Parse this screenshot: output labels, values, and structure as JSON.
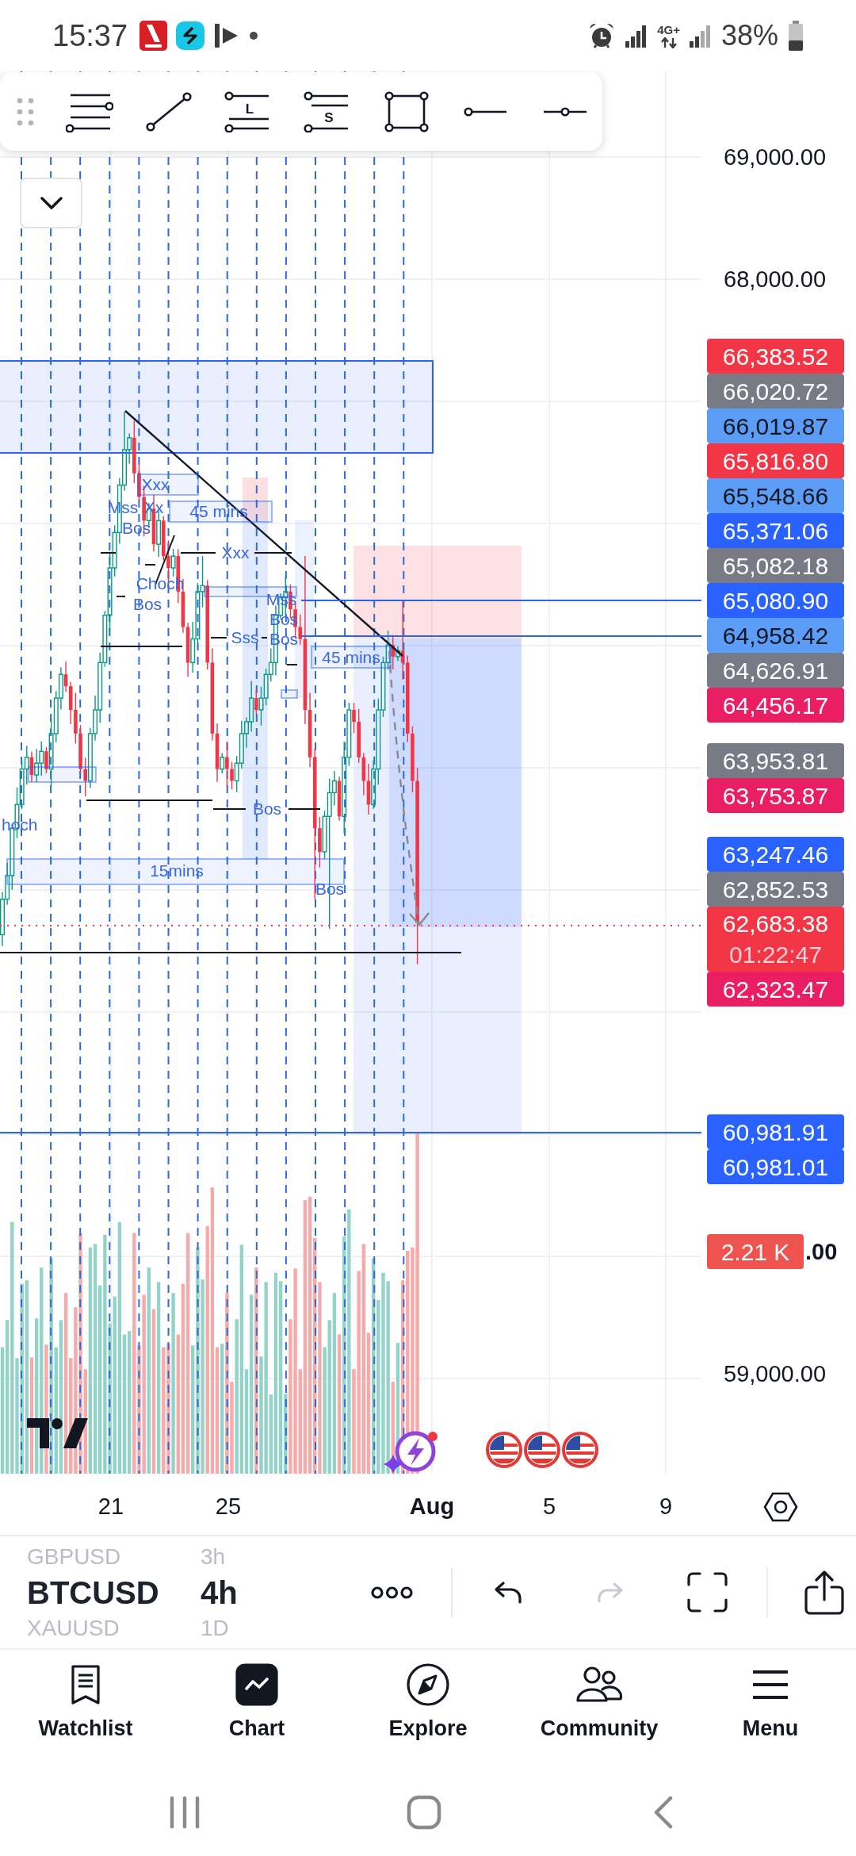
{
  "status_bar": {
    "time": "15:37",
    "network": "4G+",
    "battery": "38%"
  },
  "drawing_tools": [
    {
      "kind": "parallel"
    },
    {
      "kind": "trend"
    },
    {
      "kind": "long",
      "letter": "L"
    },
    {
      "kind": "short",
      "letter": "S"
    },
    {
      "kind": "rectangle"
    },
    {
      "kind": "ray"
    },
    {
      "kind": "horizontal"
    }
  ],
  "chart": {
    "annotations": [
      "Xxx",
      "Mss",
      "Xx",
      "45 mins",
      "Bos",
      "Xxx",
      "Choch",
      "Bos",
      "Mss",
      "Bos",
      "Sss",
      "Bos",
      "45 mins",
      "Bos",
      "hoch",
      "15mins",
      "Bos"
    ],
    "price_ticks": [
      {
        "label": "69,000.00",
        "highlighted": false
      },
      {
        "label": "68,000.00",
        "highlighted": false
      },
      {
        "label": ".00",
        "highlighted": true
      },
      {
        "label": "59,000.00",
        "highlighted": false
      }
    ],
    "price_label_groups": [
      [
        {
          "value": "66,383.52",
          "color": "#f23645"
        },
        {
          "value": "66,020.72",
          "color": "#787b86"
        },
        {
          "value": "66,019.87",
          "color": "#5b9cf6"
        },
        {
          "value": "65,816.80",
          "color": "#f23645"
        },
        {
          "value": "65,548.66",
          "color": "#5b9cf6"
        },
        {
          "value": "65,371.06",
          "color": "#2962ff"
        },
        {
          "value": "65,082.18",
          "color": "#787b86"
        },
        {
          "value": "65,080.90",
          "color": "#2962ff"
        },
        {
          "value": "64,958.42",
          "color": "#5b9cf6"
        },
        {
          "value": "64,626.91",
          "color": "#787b86"
        },
        {
          "value": "64,456.17",
          "color": "#e91e63"
        }
      ],
      [
        {
          "value": "63,953.81",
          "color": "#787b86"
        },
        {
          "value": "63,753.87",
          "color": "#e91e63"
        }
      ],
      [
        {
          "value": "63,247.46",
          "color": "#2962ff"
        },
        {
          "value": "62,852.53",
          "color": "#787b86"
        },
        {
          "value": "62,683.38",
          "countdown": "01:22:47",
          "color": "#f23645"
        },
        {
          "value": "62,323.47",
          "color": "#e91e63"
        }
      ],
      [
        {
          "value": "60,981.91",
          "color": "#2962ff"
        },
        {
          "value": "60,981.01",
          "color": "#2962ff"
        }
      ]
    ],
    "volume_label": {
      "value": "2.21 K",
      "color": "#ef5350"
    },
    "time_labels": [
      {
        "label": "21",
        "kind": "day"
      },
      {
        "label": "25",
        "kind": "day"
      },
      {
        "label": "Aug",
        "kind": "month"
      },
      {
        "label": "5",
        "kind": "day"
      },
      {
        "label": "9",
        "kind": "day"
      }
    ]
  },
  "symbol_switcher": [
    {
      "symbol": "GBPUSD",
      "interval": "3h",
      "selected": false
    },
    {
      "symbol": "BTCUSD",
      "interval": "4h",
      "selected": true
    },
    {
      "symbol": "XAUUSD",
      "interval": "1D",
      "selected": false
    }
  ],
  "toolbar_actions": [
    {
      "kind": "more",
      "disabled": false
    },
    {
      "kind": "undo",
      "disabled": false
    },
    {
      "kind": "redo",
      "disabled": true
    },
    {
      "kind": "fullscreen",
      "disabled": false
    },
    {
      "kind": "share",
      "disabled": false
    }
  ],
  "bottom_nav": [
    {
      "label": "Watchlist",
      "selected": false
    },
    {
      "label": "Chart",
      "selected": true
    },
    {
      "label": "Explore",
      "selected": false
    },
    {
      "label": "Community",
      "selected": false
    },
    {
      "label": "Menu",
      "selected": false
    }
  ]
}
